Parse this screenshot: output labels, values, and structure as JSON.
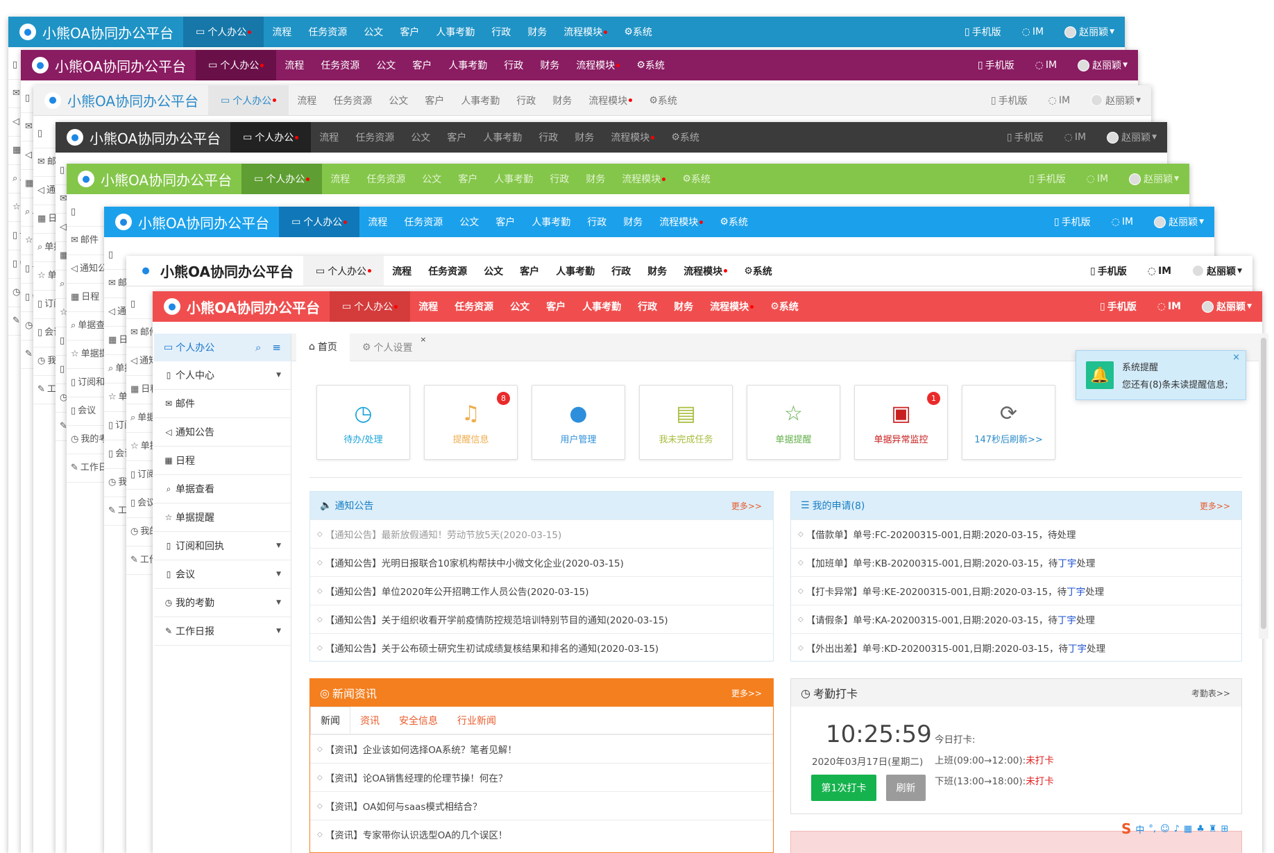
{
  "app": {
    "title": "小熊OA协同办公平台",
    "menu": [
      "流程",
      "任务资源",
      "公文",
      "客户",
      "人事考勤",
      "行政",
      "财务",
      "流程模块",
      "系统"
    ],
    "active_menu": "个人办公",
    "right_mobile": "手机版",
    "right_im": "IM",
    "user": "赵丽颖"
  },
  "themes": {
    "cyan": "#1f93c6",
    "purple": "#8a1c62",
    "light": "#f2f2f2",
    "dark": "#3b3b3b",
    "green": "#84c64a",
    "blue": "#1ba1ec",
    "white": "#ffffff",
    "red": "#f04e4e"
  },
  "side_stub": {
    "mail": "邮件",
    "notice": "通知公告",
    "schedule": "日程",
    "bill_view": "单据查看",
    "bill_remind": "单据提醒",
    "subscribe": "订阅和回执",
    "meeting": "会议",
    "attendance": "我的考勤",
    "daily": "工作日报"
  },
  "sidebar": {
    "title": "个人办公",
    "items": [
      {
        "label": "个人中心",
        "icon": "bookmark-icon",
        "dropdown": true
      },
      {
        "label": "邮件",
        "icon": "envelope-icon",
        "dropdown": false
      },
      {
        "label": "通知公告",
        "icon": "volume-icon",
        "dropdown": false
      },
      {
        "label": "日程",
        "icon": "calendar-icon",
        "dropdown": false
      },
      {
        "label": "单据查看",
        "icon": "search-icon",
        "dropdown": false
      },
      {
        "label": "单据提醒",
        "icon": "star-icon",
        "dropdown": false
      },
      {
        "label": "订阅和回执",
        "icon": "bookmark-icon",
        "dropdown": true
      },
      {
        "label": "会议",
        "icon": "bookmark-icon",
        "dropdown": true
      },
      {
        "label": "我的考勤",
        "icon": "clock-icon",
        "dropdown": true
      },
      {
        "label": "工作日报",
        "icon": "edit-icon",
        "dropdown": true
      }
    ]
  },
  "tabs": {
    "home": "首页",
    "settings": "个人设置",
    "close": "×"
  },
  "cards": [
    {
      "label": "待办/处理",
      "icon": "clock-icon",
      "color": "#1aa3d9",
      "badge": ""
    },
    {
      "label": "提醒信息",
      "icon": "bell-icon",
      "color": "#f0ad4e",
      "badge": "8"
    },
    {
      "label": "用户管理",
      "icon": "user-icon",
      "color": "#2d8fdb",
      "badge": ""
    },
    {
      "label": "我未完成任务",
      "icon": "book-icon",
      "color": "#a7bd3c",
      "badge": ""
    },
    {
      "label": "单据提醒",
      "icon": "star-icon",
      "color": "#63b04a",
      "badge": ""
    },
    {
      "label": "单据异常监控",
      "icon": "briefcase-icon",
      "color": "#c82020",
      "badge": "1"
    },
    {
      "label": "147秒后刷新>>",
      "icon": "refresh-icon",
      "color": "#666666",
      "badge": ""
    }
  ],
  "notice": {
    "title": "通知公告",
    "more": "更多>>",
    "rows": [
      "【通知公告】最新放假通知！劳动节放5天(2020-03-15)",
      "【通知公告】光明日报联合10家机构帮扶中小微文化企业(2020-03-15)",
      "【通知公告】单位2020年公开招聘工作人员公告(2020-03-15)",
      "【通知公告】关于组织收看开学前疫情防控规范培训特别节目的通知(2020-03-15)",
      "【通知公告】关于公布硕士研究生初试成绩复核结果和排名的通知(2020-03-15)"
    ]
  },
  "apply": {
    "title": "我的申请(8)",
    "more": "更多>>",
    "rows": [
      {
        "a": "【借款单】单号:FC-20200315-001,日期:2020-03-15，待处理",
        "u": "",
        "c": ""
      },
      {
        "a": "【加班单】单号:KB-20200315-001,日期:2020-03-15，待",
        "u": "丁宇",
        "c": "处理"
      },
      {
        "a": "【打卡异常】单号:KE-20200315-001,日期:2020-03-15，待",
        "u": "丁宇",
        "c": "处理"
      },
      {
        "a": "【请假条】单号:KA-20200315-001,日期:2020-03-15，待",
        "u": "丁宇",
        "c": "处理"
      },
      {
        "a": "【外出出差】单号:KD-20200315-001,日期:2020-03-15，待",
        "u": "丁宇",
        "c": "处理"
      }
    ]
  },
  "news": {
    "title": "新闻资讯",
    "more": "更多>>",
    "tabs": [
      "新闻",
      "资讯",
      "安全信息",
      "行业新闻"
    ],
    "rows": [
      "【资讯】企业该如何选择OA系统？笔者见解！",
      "【资讯】论OA销售经理的伦理节操！何在？",
      "【资讯】OA如何与saas模式相结合？",
      "【资讯】专家带你认识选型OA的几个误区！"
    ]
  },
  "attend": {
    "title": "考勤打卡",
    "more": "考勤表>>",
    "time": "10:25:59",
    "date": "2020年03月17日(星期二)",
    "today": "今日打卡:",
    "on": "上班(09:00→12:00):",
    "on_status": "未打卡",
    "off": "下班(13:00→18:00):",
    "off_status": "未打卡",
    "punch": "第1次打卡",
    "refresh": "刷新"
  },
  "toast": {
    "title": "系统提醒",
    "msg": "您还有(8)条未读提醒信息;",
    "close": "×"
  },
  "ime": {
    "lang": "中"
  }
}
